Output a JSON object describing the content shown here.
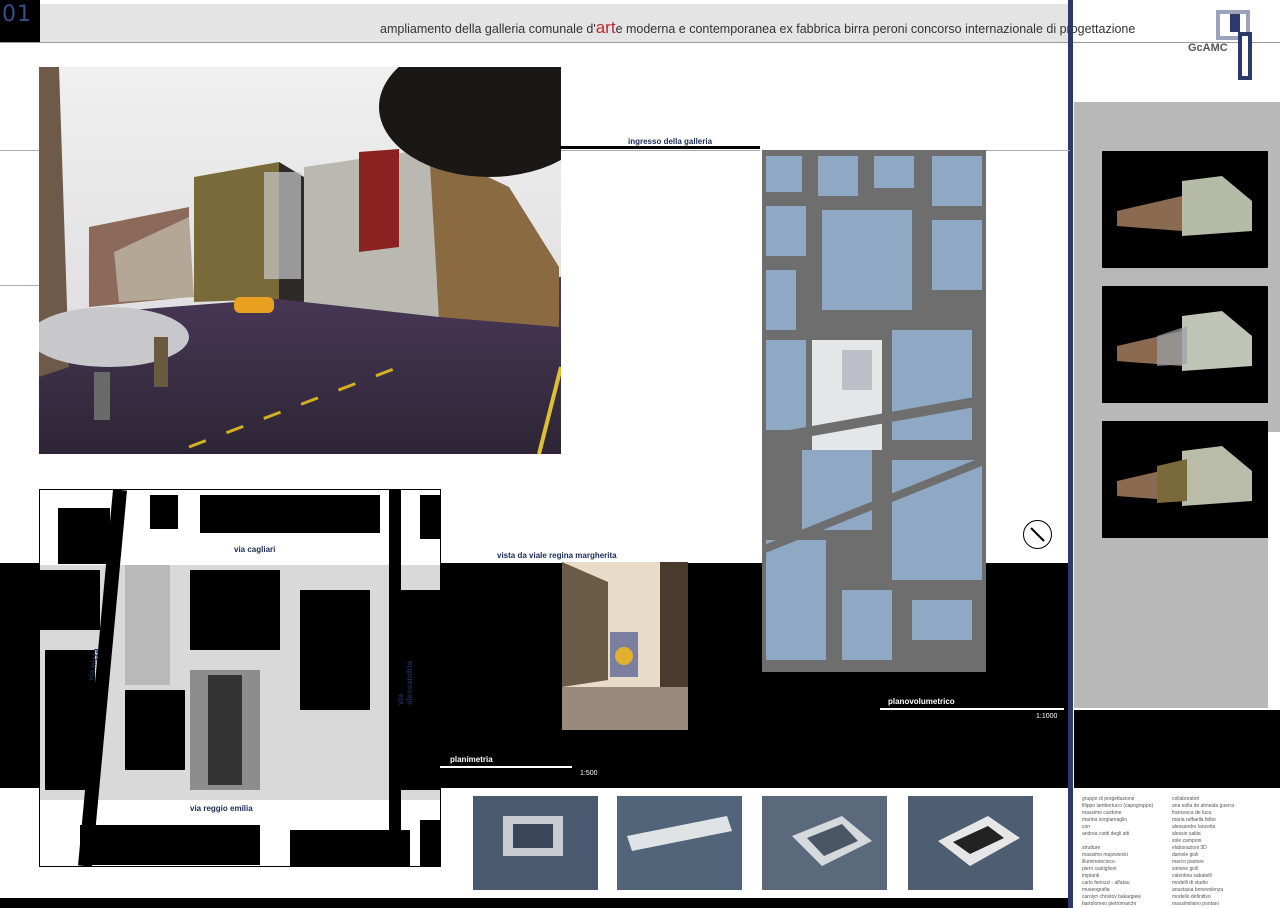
{
  "header": {
    "sheet_number": "01",
    "title_before": "ampliamento della galleria comunale d'",
    "title_accent": "art",
    "title_after": "e moderna e contemporanea ex fabbrica birra peroni  concorso internazionale di progettazione",
    "logo_text": "GcAMC"
  },
  "labels": {
    "entrance": "ingresso della galleria",
    "view": "vista da viale regina margherita",
    "planovolumetrico": "planovolumetrico",
    "planovolumetrico_scale": "1:1000",
    "planimetria": "planimetria",
    "planimetria_scale": "1:500"
  },
  "streets": {
    "cagliari": "via cagliari",
    "nizza": "via nizza",
    "alessandria": "via alessandria",
    "reggio_emilia": "via reggio emilia"
  },
  "credits": {
    "col1": "gruppo di progettazione\nfilippo lambertucci (capogruppo)\nmassimo cardone\nmarina sorgiamaglio\ncon\nandrea ciotti degli atti\n\nstrutture\nmassimo majowiecki\nilluminotecnico\npiero castiglioni\nimpianti\ncarlo feriozzi - alfatau\nmuseografia\ncarolyn christov bakargiew\nbartolomeo pietromarchi",
    "col2": "collaboratori\nana sofia de almeida guerra\nfrancesca de luca\nmaria raffaella felbo\nalessandro lanzetta\nalessio salita\nsole zamponi\nelaborazioni 3D\ndaniele gioli\nmarco pastore\nsimone gioli\nvalentina sabatelli\nmodelli di studio\nanastasia benevolenza\nmodello definitivo\nmassimiliano pontani"
  },
  "colors": {
    "accent": "#c0282e",
    "navy": "#2b3a6b",
    "building_blue": "#8fa9c4",
    "ground_gray": "#6e6e6e"
  }
}
